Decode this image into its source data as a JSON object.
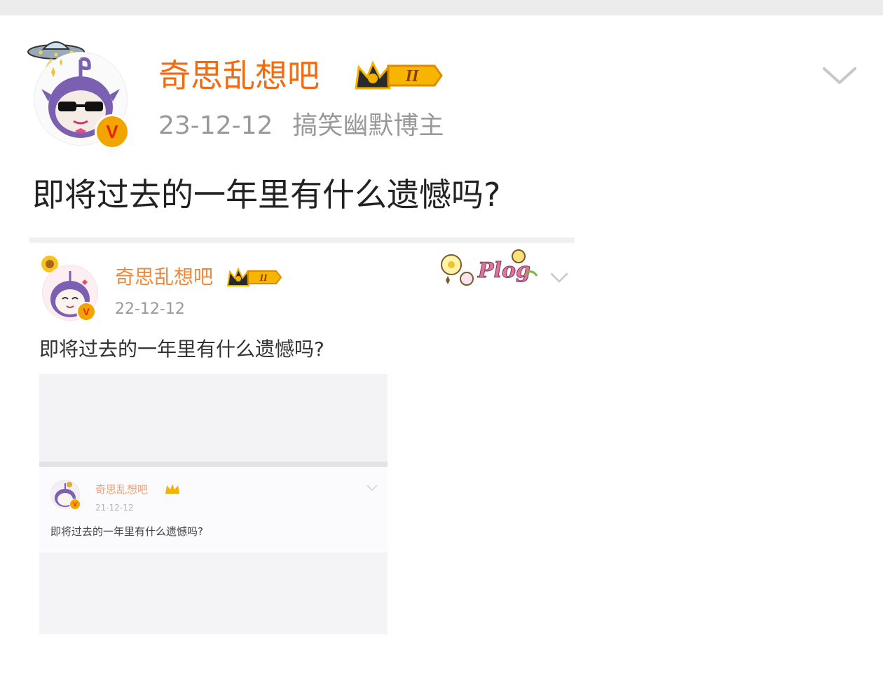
{
  "post": {
    "username": "奇思乱想吧",
    "level_badge": "II",
    "date": "23-12-12",
    "user_tag": "搞笑幽默博主",
    "verified_badge": "V",
    "content": "即将过去的一年里有什么遗憾吗?"
  },
  "nested_post_1": {
    "username": "奇思乱想吧",
    "level_badge": "II",
    "date": "22-12-12",
    "verified_badge": "V",
    "content": "即将过去的一年里有什么遗憾吗?",
    "sticker_text": "Plog"
  },
  "nested_post_2": {
    "username": "奇思乱想吧",
    "date": "21-12-12",
    "content": "即将过去的一年里有什么遗憾吗?"
  },
  "colors": {
    "username": "#f26b10",
    "meta": "#999999",
    "verified_gold": "#f7b500",
    "verified_red": "#e8220a",
    "avatar_purple": "#7b5fb0"
  },
  "icons": {
    "more": "chevron-down-icon",
    "verified": "verified-v-icon",
    "level": "crown-level-icon"
  }
}
